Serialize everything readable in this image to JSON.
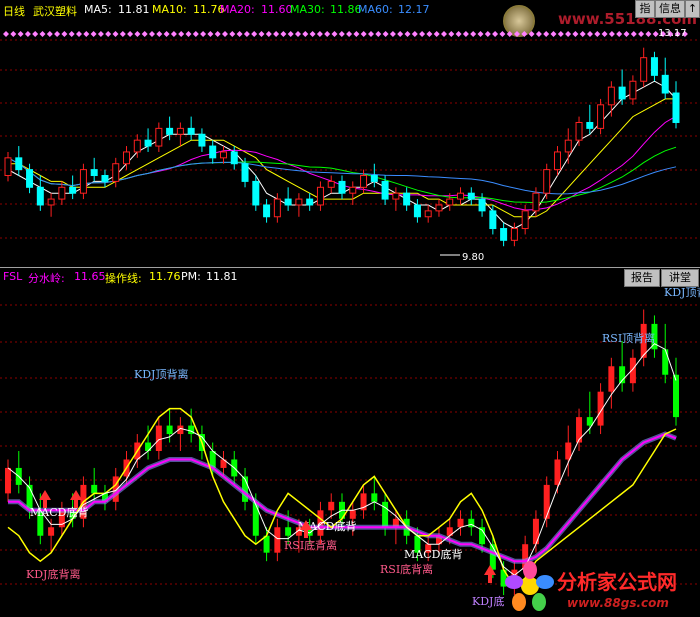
{
  "header": {
    "period": "日线",
    "stock": "武汉塑料",
    "ma": [
      {
        "label": "MA5:",
        "value": "11.81",
        "color": "#ffffff"
      },
      {
        "label": "MA10:",
        "value": "11.76",
        "color": "#ffff00"
      },
      {
        "label": "MA20:",
        "value": "11.60",
        "color": "#ff00ff"
      },
      {
        "label": "MA30:",
        "value": "11.86",
        "color": "#00ff00"
      },
      {
        "label": "MA60:",
        "value": "12.17",
        "color": "#3a8dff"
      }
    ],
    "buttons": [
      "指",
      "信息",
      "↑"
    ]
  },
  "watermark": {
    "url": "www.55188.com"
  },
  "price_pane": {
    "high_label": "13.17",
    "low_label": "9.80"
  },
  "indicator": {
    "name": "FSL",
    "items": [
      {
        "label": "分水岭:",
        "value": "11.65",
        "color": "#ff00ff"
      },
      {
        "label": "操作线:",
        "value": "11.76",
        "color": "#ffff00"
      },
      {
        "label": "PM:",
        "value": "11.81",
        "color": "#ffffff"
      }
    ],
    "buttons": [
      "报告",
      "讲堂"
    ]
  },
  "annotations": {
    "kdj_top_1": "KDJ顶背离",
    "kdj_top_2": "KDJ顶背",
    "rsi_top": "RSI顶背离",
    "macd_bottom_1": "MACD底背",
    "macd_bottom_2": "MACD底背",
    "macd_bottom_3": "MACD底背",
    "rsi_bottom_1": "RSI底背离",
    "rsi_bottom_2": "RSI底背离",
    "kdj_bottom_1": "KDJ底背离",
    "kdj_bottom_2": "KDJ底"
  },
  "logo": {
    "name": "分析家公式网",
    "url": "www.88gs.com"
  },
  "colors": {
    "up": "#ff2020",
    "down": "#00ffff",
    "up2": "#ff2020",
    "down2": "#00ff00",
    "grid": "#8b0000"
  },
  "chart_data": {
    "type": "candlestick",
    "price_candles": [
      [
        11.0,
        11.4,
        10.9,
        11.3
      ],
      [
        11.3,
        11.5,
        11.0,
        11.1
      ],
      [
        11.1,
        11.2,
        10.7,
        10.8
      ],
      [
        10.8,
        11.0,
        10.4,
        10.5
      ],
      [
        10.5,
        10.7,
        10.3,
        10.6
      ],
      [
        10.6,
        10.9,
        10.5,
        10.8
      ],
      [
        10.8,
        11.0,
        10.6,
        10.7
      ],
      [
        10.7,
        11.2,
        10.6,
        11.1
      ],
      [
        11.1,
        11.3,
        10.9,
        11.0
      ],
      [
        11.0,
        11.1,
        10.8,
        10.9
      ],
      [
        10.9,
        11.3,
        10.8,
        11.2
      ],
      [
        11.2,
        11.5,
        11.1,
        11.4
      ],
      [
        11.4,
        11.7,
        11.3,
        11.6
      ],
      [
        11.6,
        11.8,
        11.4,
        11.5
      ],
      [
        11.5,
        11.9,
        11.4,
        11.8
      ],
      [
        11.8,
        12.0,
        11.6,
        11.7
      ],
      [
        11.7,
        11.9,
        11.5,
        11.8
      ],
      [
        11.8,
        12.0,
        11.6,
        11.7
      ],
      [
        11.7,
        11.8,
        11.4,
        11.5
      ],
      [
        11.5,
        11.6,
        11.2,
        11.3
      ],
      [
        11.3,
        11.5,
        11.2,
        11.4
      ],
      [
        11.4,
        11.5,
        11.1,
        11.2
      ],
      [
        11.2,
        11.3,
        10.8,
        10.9
      ],
      [
        10.9,
        11.0,
        10.4,
        10.5
      ],
      [
        10.5,
        10.6,
        10.2,
        10.3
      ],
      [
        10.3,
        10.7,
        10.2,
        10.6
      ],
      [
        10.6,
        10.8,
        10.4,
        10.5
      ],
      [
        10.5,
        10.7,
        10.3,
        10.6
      ],
      [
        10.6,
        10.7,
        10.4,
        10.5
      ],
      [
        10.5,
        10.9,
        10.4,
        10.8
      ],
      [
        10.8,
        11.0,
        10.7,
        10.9
      ],
      [
        10.9,
        11.0,
        10.6,
        10.7
      ],
      [
        10.7,
        10.9,
        10.5,
        10.8
      ],
      [
        10.8,
        11.1,
        10.7,
        11.0
      ],
      [
        11.0,
        11.2,
        10.8,
        10.9
      ],
      [
        10.9,
        11.0,
        10.5,
        10.6
      ],
      [
        10.6,
        10.8,
        10.4,
        10.7
      ],
      [
        10.7,
        10.8,
        10.4,
        10.5
      ],
      [
        10.5,
        10.6,
        10.2,
        10.3
      ],
      [
        10.3,
        10.5,
        10.2,
        10.4
      ],
      [
        10.4,
        10.6,
        10.3,
        10.5
      ],
      [
        10.5,
        10.7,
        10.4,
        10.6
      ],
      [
        10.6,
        10.8,
        10.5,
        10.7
      ],
      [
        10.7,
        10.8,
        10.5,
        10.6
      ],
      [
        10.6,
        10.7,
        10.3,
        10.4
      ],
      [
        10.4,
        10.5,
        10.0,
        10.1
      ],
      [
        10.1,
        10.2,
        9.8,
        9.9
      ],
      [
        9.9,
        10.2,
        9.8,
        10.1
      ],
      [
        10.1,
        10.5,
        10.0,
        10.4
      ],
      [
        10.4,
        10.8,
        10.3,
        10.7
      ],
      [
        10.7,
        11.2,
        10.6,
        11.1
      ],
      [
        11.1,
        11.5,
        11.0,
        11.4
      ],
      [
        11.4,
        11.8,
        11.2,
        11.6
      ],
      [
        11.6,
        12.0,
        11.5,
        11.9
      ],
      [
        11.9,
        12.2,
        11.7,
        11.8
      ],
      [
        11.8,
        12.3,
        11.7,
        12.2
      ],
      [
        12.2,
        12.6,
        12.0,
        12.5
      ],
      [
        12.5,
        12.8,
        12.2,
        12.3
      ],
      [
        12.3,
        12.7,
        12.2,
        12.6
      ],
      [
        12.6,
        13.17,
        12.5,
        13.0
      ],
      [
        13.0,
        13.1,
        12.6,
        12.7
      ],
      [
        12.7,
        13.0,
        12.3,
        12.4
      ],
      [
        12.4,
        12.6,
        11.8,
        11.9
      ]
    ],
    "price_ma": {
      "MA5": [
        11.1,
        11.0,
        10.9,
        10.8,
        10.7,
        10.7,
        10.7,
        10.8,
        10.9,
        10.9,
        11.0,
        11.2,
        11.4,
        11.5,
        11.6,
        11.7,
        11.7,
        11.7,
        11.7,
        11.6,
        11.5,
        11.4,
        11.2,
        11.0,
        10.7,
        10.6,
        10.5,
        10.5,
        10.5,
        10.6,
        10.7,
        10.7,
        10.8,
        10.8,
        10.9,
        10.8,
        10.7,
        10.6,
        10.5,
        10.5,
        10.4,
        10.5,
        10.5,
        10.6,
        10.6,
        10.4,
        10.2,
        10.1,
        10.2,
        10.4,
        10.7,
        11.0,
        11.3,
        11.6,
        11.7,
        11.9,
        12.1,
        12.3,
        12.4,
        12.5,
        12.6,
        12.5,
        12.3
      ],
      "MA10": [
        11.2,
        11.2,
        11.1,
        11.0,
        10.9,
        10.9,
        10.8,
        10.8,
        10.8,
        10.8,
        10.9,
        11.0,
        11.1,
        11.2,
        11.3,
        11.4,
        11.5,
        11.6,
        11.6,
        11.6,
        11.6,
        11.5,
        11.4,
        11.3,
        11.1,
        11.0,
        10.9,
        10.8,
        10.7,
        10.6,
        10.6,
        10.6,
        10.6,
        10.7,
        10.7,
        10.7,
        10.7,
        10.7,
        10.7,
        10.6,
        10.6,
        10.5,
        10.5,
        10.5,
        10.5,
        10.5,
        10.4,
        10.3,
        10.3,
        10.3,
        10.4,
        10.6,
        10.8,
        11.0,
        11.2,
        11.4,
        11.6,
        11.8,
        12.0,
        12.1,
        12.2,
        12.3,
        12.3
      ]
    },
    "indicator_lines": {
      "分水岭": [
        10.9,
        10.9,
        10.8,
        10.8,
        10.8,
        10.8,
        10.8,
        10.8,
        10.9,
        10.9,
        11.0,
        11.1,
        11.2,
        11.3,
        11.35,
        11.4,
        11.4,
        11.4,
        11.35,
        11.3,
        11.2,
        11.1,
        11.0,
        10.9,
        10.8,
        10.75,
        10.7,
        10.65,
        10.6,
        10.6,
        10.6,
        10.6,
        10.6,
        10.6,
        10.6,
        10.6,
        10.6,
        10.6,
        10.55,
        10.5,
        10.5,
        10.45,
        10.4,
        10.4,
        10.35,
        10.3,
        10.25,
        10.2,
        10.2,
        10.25,
        10.35,
        10.5,
        10.65,
        10.8,
        10.95,
        11.1,
        11.25,
        11.4,
        11.5,
        11.6,
        11.65,
        11.7,
        11.65
      ],
      "操作线": [
        10.6,
        10.5,
        10.3,
        10.2,
        10.3,
        10.5,
        10.7,
        10.9,
        11.0,
        11.0,
        11.1,
        11.3,
        11.5,
        11.7,
        11.9,
        12.0,
        12.0,
        11.9,
        11.6,
        11.2,
        10.9,
        10.7,
        10.5,
        10.4,
        10.5,
        10.8,
        11.0,
        10.9,
        10.8,
        10.7,
        10.6,
        10.7,
        10.9,
        11.1,
        11.2,
        11.0,
        10.8,
        10.6,
        10.5,
        10.5,
        10.6,
        10.7,
        10.9,
        11.0,
        10.8,
        10.5,
        10.1,
        9.9,
        10.0,
        10.2,
        10.3,
        10.4,
        10.5,
        10.6,
        10.7,
        10.8,
        10.9,
        11.0,
        11.1,
        11.3,
        11.5,
        11.7,
        11.76
      ]
    }
  }
}
